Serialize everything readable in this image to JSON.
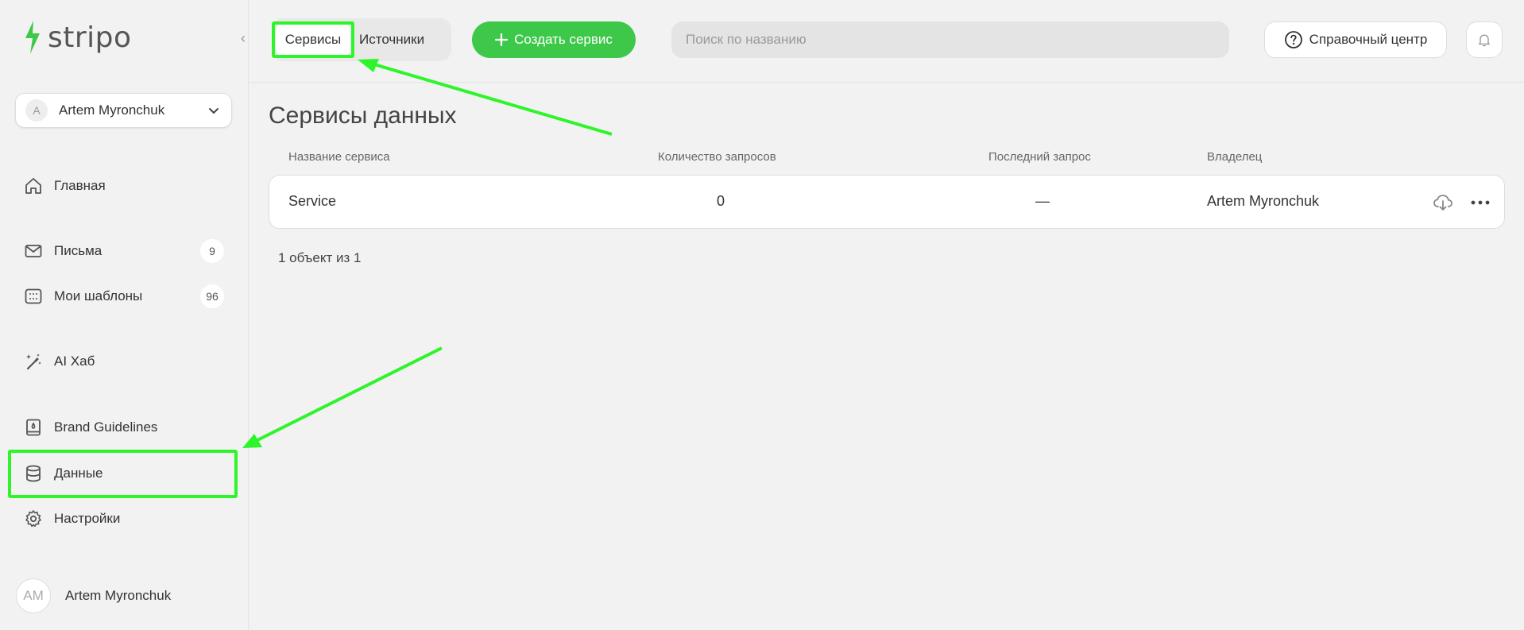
{
  "app": {
    "logo_text": "stripo"
  },
  "sidebar": {
    "account": {
      "avatar_letter": "A",
      "name": "Artem Myronchuk"
    },
    "items": [
      {
        "label": "Главная",
        "icon": "home-icon"
      },
      {
        "label": "Письма",
        "icon": "mail-icon",
        "badge": "9"
      },
      {
        "label": "Мои шаблоны",
        "icon": "templates-icon",
        "badge": "96"
      },
      {
        "label": "AI Хаб",
        "icon": "magic-wand-icon"
      },
      {
        "label": "Brand Guidelines",
        "icon": "brand-book-icon"
      },
      {
        "label": "Данные",
        "icon": "database-icon",
        "active": true
      },
      {
        "label": "Настройки",
        "icon": "gear-icon"
      }
    ],
    "user": {
      "initials": "AM",
      "name": "Artem Myronchuk"
    }
  },
  "topbar": {
    "tabs": [
      {
        "label": "Сервисы",
        "active": true
      },
      {
        "label": "Источники"
      }
    ],
    "create_button": "Создать сервис",
    "search_placeholder": "Поиск по названию",
    "help_button": "Справочный центр"
  },
  "main": {
    "title": "Сервисы данных",
    "columns": [
      "Название сервиса",
      "Количество запросов",
      "Последний запрос",
      "Владелец"
    ],
    "rows": [
      {
        "name": "Service",
        "requests": "0",
        "last_request": "—",
        "owner": "Artem Myronchuk"
      }
    ],
    "pagination_text": "1 объект из 1"
  },
  "colors": {
    "accent": "#3ec84a",
    "annotation": "#2ef52a"
  }
}
